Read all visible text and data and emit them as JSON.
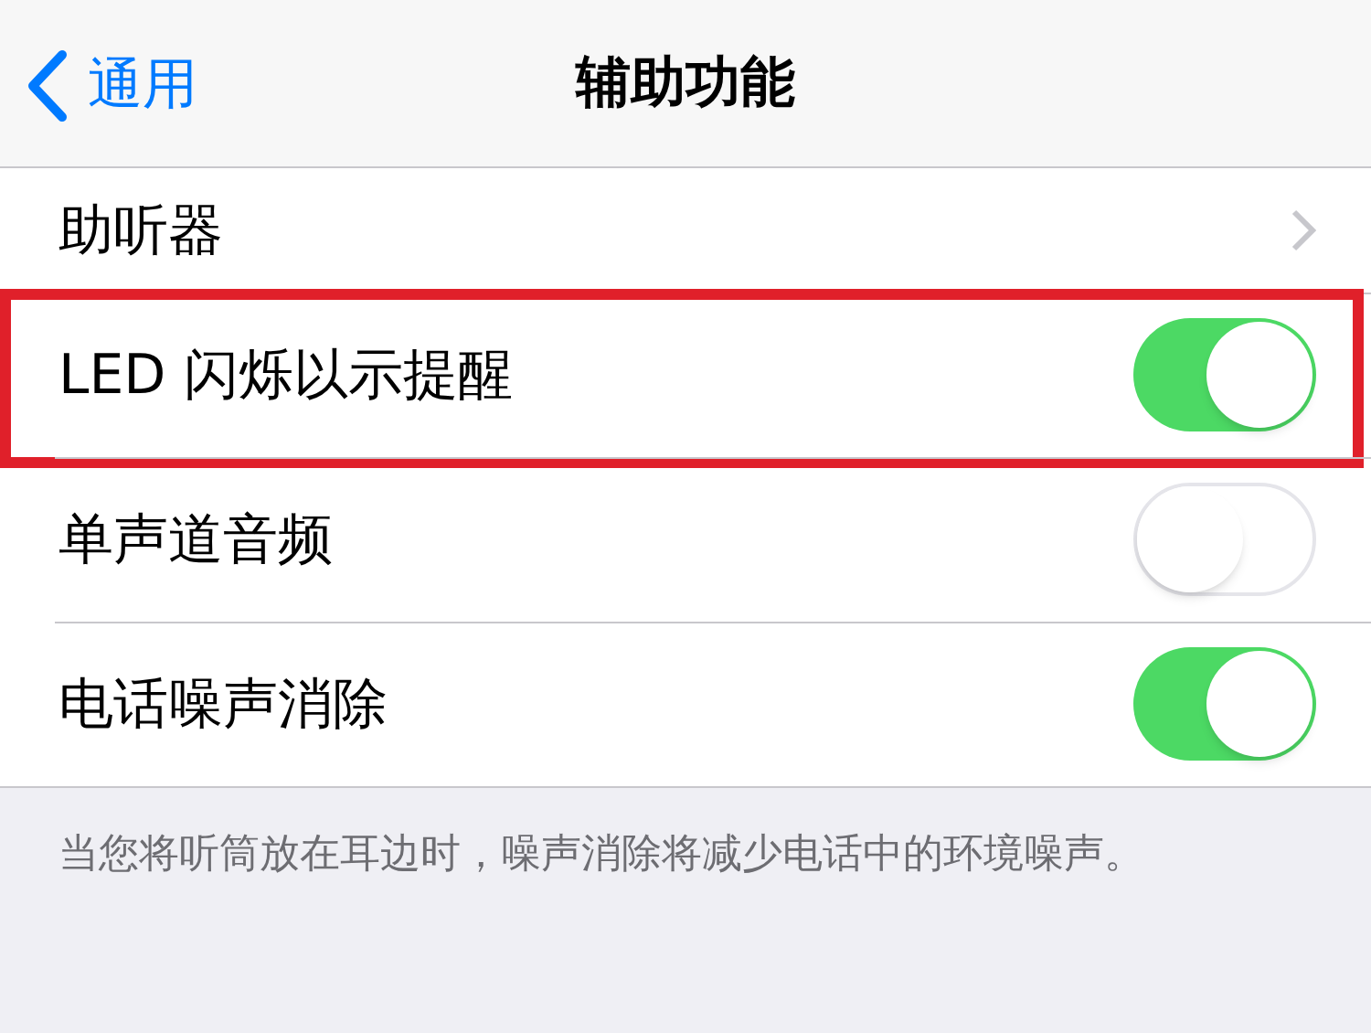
{
  "nav": {
    "back_label": "通用",
    "title": "辅助功能"
  },
  "rows": [
    {
      "kind": "link",
      "label": "助听器",
      "highlighted": false
    },
    {
      "kind": "toggle",
      "label": "LED 闪烁以示提醒",
      "on": true,
      "highlighted": true
    },
    {
      "kind": "toggle",
      "label": "单声道音频",
      "on": false,
      "highlighted": false
    },
    {
      "kind": "toggle",
      "label": "电话噪声消除",
      "on": true,
      "highlighted": false
    }
  ],
  "footer": "当您将听筒放在耳边时，噪声消除将减少电话中的环境噪声。"
}
